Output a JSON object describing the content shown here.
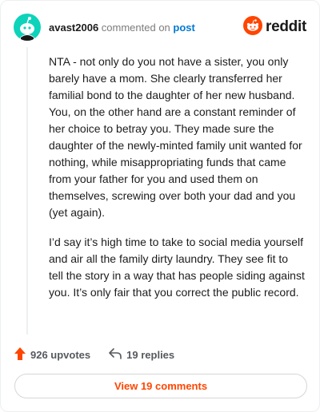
{
  "header": {
    "username": "avast2006",
    "action_text": "commented on",
    "post_link": "post",
    "brand_text": "reddit",
    "avatar_icon": "snoo-avatar-icon",
    "brand_icon": "reddit-logo-icon"
  },
  "comment": {
    "paragraphs": [
      "NTA - not only do you not have a sister, you only barely have a mom. She clearly transferred her familial bond to the daughter of her new husband. You, on the other hand are a constant reminder of her choice to betray you. They made sure the daughter of the newly-minted family unit wanted for nothing, while misappropriating funds that came from your father for you and used them on themselves, screwing over both your dad and you (yet again).",
      "I’d say it’s high time to take to social media yourself and air all the family dirty laundry. They see fit to tell the story in a way that has people siding against you. It’s only fair that you correct the public record."
    ]
  },
  "actions": {
    "upvotes": "926 upvotes",
    "replies": "19 replies",
    "upvote_icon": "upvote-arrow-icon",
    "reply_icon": "reply-arrow-icon"
  },
  "footer": {
    "view_comments_label": "View 19 comments"
  },
  "colors": {
    "brand": "#ff4500",
    "link": "#0079d3",
    "avatar_bg": "#0dd3bb",
    "text": "#1c1c1c",
    "muted": "#7c7c7c"
  }
}
